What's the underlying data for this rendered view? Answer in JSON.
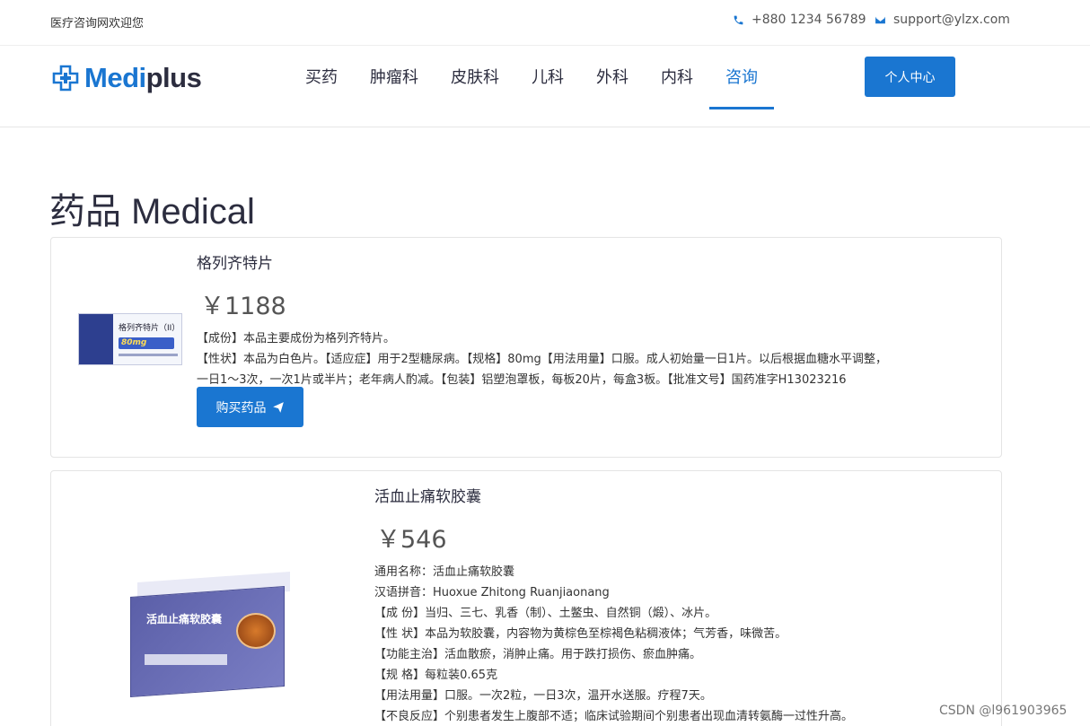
{
  "topbar": {
    "welcome": "医疗咨询网欢迎您",
    "phone": "+880 1234 56789",
    "email": "support@ylzx.com"
  },
  "header": {
    "brand_part1": "Medi",
    "brand_part2": "plus",
    "nav": [
      {
        "label": "买药"
      },
      {
        "label": "肿瘤科"
      },
      {
        "label": "皮肤科"
      },
      {
        "label": "儿科"
      },
      {
        "label": "外科"
      },
      {
        "label": "内科"
      },
      {
        "label": "咨询",
        "active": true
      }
    ],
    "account_button": "个人中心"
  },
  "page": {
    "title": "药品 Medical"
  },
  "products": [
    {
      "name": "格列齐特片",
      "price": "￥1188",
      "box_label": "格列齐特片（II）",
      "box_badge": "80mg",
      "desc": [
        "【成份】本品主要成份为格列齐特片。",
        "【性状】本品为白色片。【适应症】用于2型糖尿病。【规格】80mg【用法用量】口服。成人初始量一日1片。以后根据血糖水平调整，",
        "一日1～3次，一次1片或半片；老年病人酌减。【包装】铝塑泡罩板，每板20片，每盒3板。【批准文号】国药准字H13023216"
      ],
      "buy_label": "购买药品"
    },
    {
      "name": "活血止痛软胶囊",
      "price": "￥546",
      "box_label": "活血止痛软胶囊",
      "desc": [
        "通用名称：活血止痛软胶囊",
        "汉语拼音：Huoxue Zhitong Ruanjiaonang",
        "【成 份】当归、三七、乳香（制）、土鳖虫、自然铜（煅）、冰片。",
        "【性 状】本品为软胶囊，内容物为黄棕色至棕褐色粘稠液体；气芳香，味微苦。",
        "【功能主治】活血散瘀，消肿止痛。用于跌打损伤、瘀血肿痛。",
        "【规 格】每粒装0.65克",
        "【用法用量】口服。一次2粒，一日3次，温开水送服。疗程7天。",
        "【不良反应】个别患者发生上腹部不适；临床试验期间个别患者出现血清转氨酶一过性升高。"
      ]
    }
  ],
  "watermark": "CSDN @l961903965",
  "colors": {
    "accent": "#1a76d1",
    "text": "#2c2d3f"
  }
}
